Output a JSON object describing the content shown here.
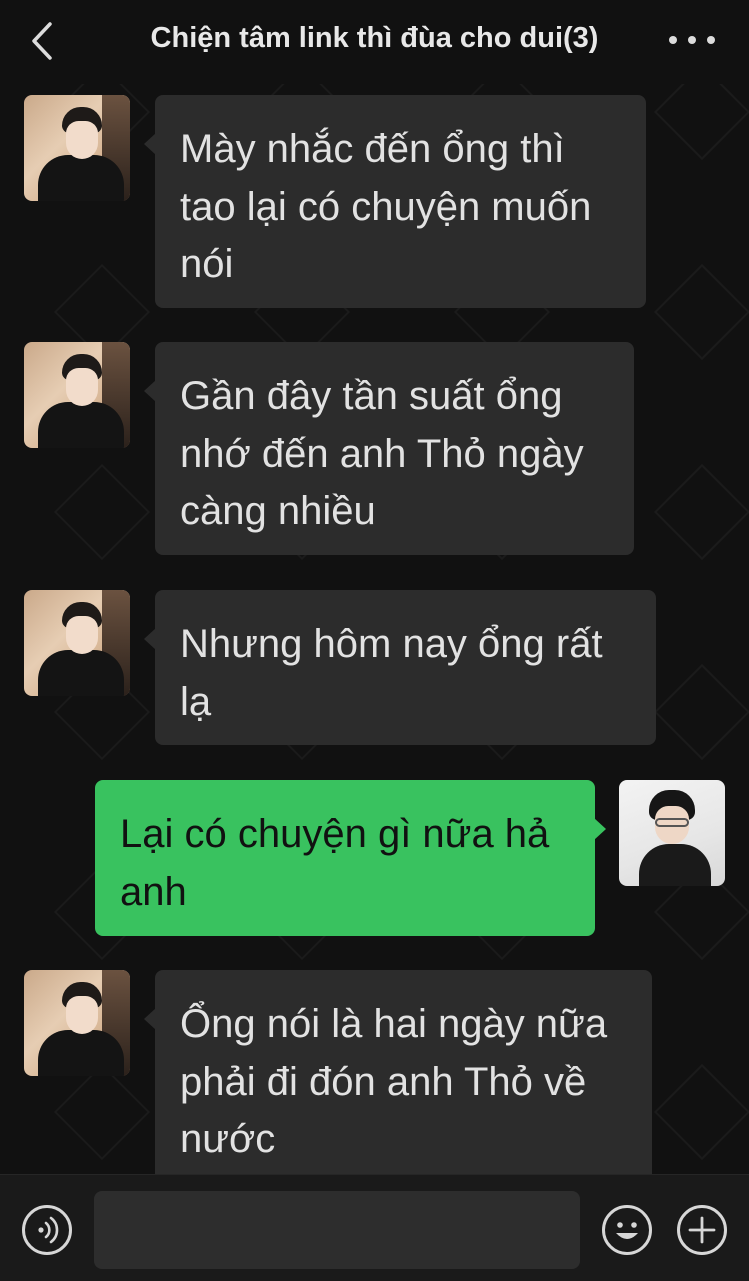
{
  "header": {
    "title": "Chiện tâm link thì đùa cho dui(3)"
  },
  "messages": [
    {
      "sender": "other",
      "text": "Mày nhắc đến ổng thì tao lại có chuyện muốn nói"
    },
    {
      "sender": "other",
      "text": "Gần đây tần suất ổng nhớ đến anh Thỏ ngày càng nhiều"
    },
    {
      "sender": "other",
      "text": "Nhưng hôm nay ổng rất lạ"
    },
    {
      "sender": "me",
      "text": "Lại có chuyện gì nữa hả anh"
    },
    {
      "sender": "other",
      "text": "Ổng nói là hai ngày nữa phải đi đón anh Thỏ về nước"
    }
  ],
  "input": {
    "value": "",
    "placeholder": ""
  },
  "icons": {
    "back": "chevron-left-icon",
    "more": "more-icon",
    "voice": "voice-icon",
    "emoji": "emoji-icon",
    "add": "plus-icon"
  },
  "colors": {
    "background": "#111111",
    "bubble_other": "#2c2c2c",
    "bubble_mine": "#39c25f",
    "text": "#e2e2e2"
  }
}
